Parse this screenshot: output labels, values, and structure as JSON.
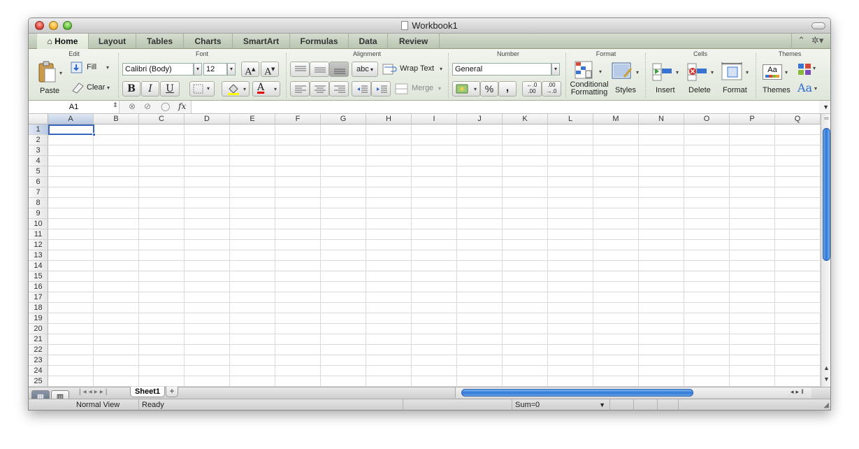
{
  "window": {
    "title": "Workbook1"
  },
  "tabs": [
    "Home",
    "Layout",
    "Tables",
    "Charts",
    "SmartArt",
    "Formulas",
    "Data",
    "Review"
  ],
  "ribbon": {
    "groups": {
      "edit": "Edit",
      "font": "Font",
      "alignment": "Alignment",
      "number": "Number",
      "format": "Format",
      "cells": "Cells",
      "themes": "Themes"
    },
    "edit": {
      "paste": "Paste",
      "fill": "Fill",
      "clear": "Clear"
    },
    "font": {
      "name": "Calibri (Body)",
      "size": "12",
      "bold": "B",
      "italic": "I",
      "underline": "U",
      "grow": "A",
      "shrink": "A",
      "color_glyph": "A"
    },
    "alignment": {
      "wrap_text": "Wrap Text",
      "merge": "Merge",
      "orientation": "abc"
    },
    "number": {
      "format": "General",
      "percent": "%",
      "comma": ","
    },
    "format": {
      "conditional_line1": "Conditional",
      "conditional_line2": "Formatting",
      "styles": "Styles"
    },
    "cells": {
      "insert": "Insert",
      "delete": "Delete",
      "format": "Format"
    },
    "themes": {
      "themes": "Themes",
      "aa": "Aa"
    }
  },
  "formula_bar": {
    "name_box": "A1",
    "fx": "fx",
    "value": ""
  },
  "grid": {
    "columns": [
      "A",
      "B",
      "C",
      "D",
      "E",
      "F",
      "G",
      "H",
      "I",
      "J",
      "K",
      "L",
      "M",
      "N",
      "O",
      "P",
      "Q"
    ],
    "rows": [
      "1",
      "2",
      "3",
      "4",
      "5",
      "6",
      "7",
      "8",
      "9",
      "10",
      "11",
      "12",
      "13",
      "14",
      "15",
      "16",
      "17",
      "18",
      "19",
      "20",
      "21",
      "22",
      "23",
      "24",
      "25"
    ],
    "selected_cell": "A1"
  },
  "sheets": [
    "Sheet1"
  ],
  "status": {
    "view": "Normal View",
    "state": "Ready",
    "sum": "Sum=0"
  },
  "colors": {
    "accent": "#3565c1",
    "ribbon_bg": "#e6ece2",
    "scroll_thumb": "#2f78d8"
  }
}
